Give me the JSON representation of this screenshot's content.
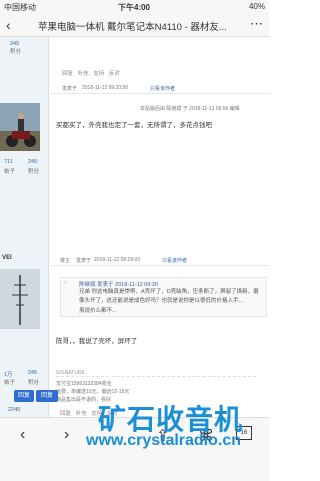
{
  "status_bar": {
    "carrier": "中国移动",
    "time": "下午4:00",
    "battery": "40%"
  },
  "title_bar": {
    "back_icon": "chevron-left-icon",
    "title": "苹果电脑一体机 戴尔笔记本N4110 - 器材友...",
    "more_icon": "ellipsis-icon"
  },
  "sidebar": {
    "top_block": {
      "num1": "245",
      "label1": "积分"
    },
    "user1": {
      "posts": "711",
      "posts_label": "帖子",
      "points": "245",
      "points_label": "积分"
    },
    "user2": {
      "name": "VEI",
      "posts": "1万",
      "posts_label": "帖子",
      "points": "245",
      "points_label": "积分"
    },
    "bottom_num": "2245"
  },
  "posts": [
    {
      "actions": [
        "回复",
        "补充",
        "支持",
        "反对"
      ],
      "author_tag": "发表于",
      "time": "2018-11-12 09:20:50",
      "only_author": "只看该作者",
      "edit_note": "本帖最后由 陈继斌 于 2018-11-12 09:56 编辑",
      "content": "买都买了，外壳我也定了一套，无所谓了，多花点钱吧"
    },
    {
      "floor": "楼主",
      "author_tag": "发表于",
      "time": "2018-11-12 09:29:03",
      "only_author": "只看该作者",
      "quote_author": "陈继斌 发表于 2018-11-12 09:20",
      "quote_text": "兄弟 你这电脑真是惨啊，A壳坏了，D壳缺角，压条断了，屏裂了换新，摄像头坏了，这还能说是成色好吗？也就是说你是以很低的价格入手...",
      "quote_text2": "虽说价么都不...",
      "content": "陈哥，，我说了壳坏，屏坏了",
      "divider_label": "SIGNATURE",
      "sig1": "支付宝15963132384收全",
      "sig2": "运费，单编送10元，偏远12-15元",
      "sig3": "物品售出是不退的，看好",
      "actions": [
        "回复",
        "补充",
        "支持",
        "反对"
      ]
    }
  ],
  "bottom": {
    "reply_label": "回复",
    "post_reply_label": "回复",
    "watermark_cn": "矿石收音机",
    "watermark_url": "www.crystalradio.cn",
    "tab_count": "16"
  }
}
